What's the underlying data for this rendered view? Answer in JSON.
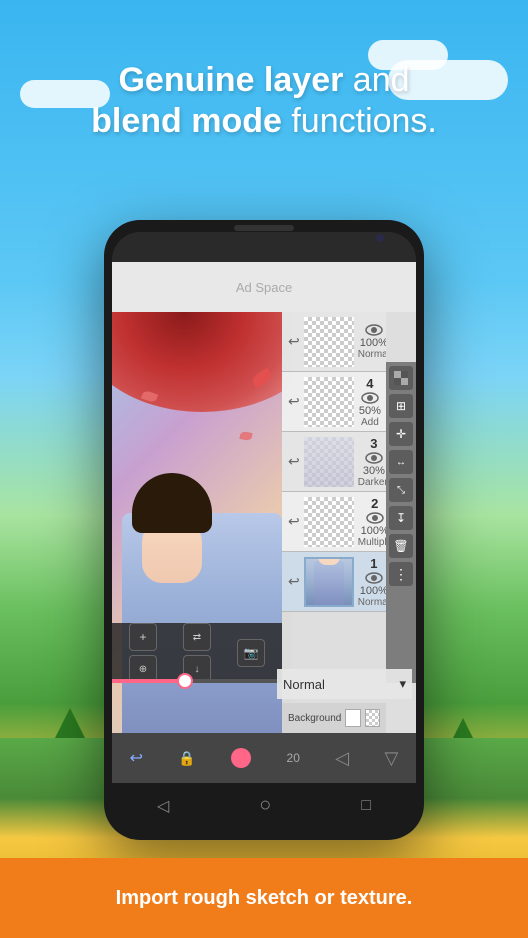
{
  "header": {
    "line1_bold": "Genuine layer",
    "line1_normal": " and",
    "line2_bold": "blend mode",
    "line2_normal": " functions."
  },
  "ad": {
    "text": "Ad Space"
  },
  "layers": [
    {
      "number": "",
      "opacity": "100%",
      "blend": "Normal",
      "thumbnail": "checkered-top"
    },
    {
      "number": "4",
      "opacity": "50%",
      "blend": "Add",
      "thumbnail": "checkered-4"
    },
    {
      "number": "3",
      "opacity": "30%",
      "blend": "Darken",
      "thumbnail": "checkered-3"
    },
    {
      "number": "2",
      "opacity": "100%",
      "blend": "Multiply",
      "thumbnail": "checkered-2"
    },
    {
      "number": "1",
      "opacity": "100%",
      "blend": "Normal",
      "thumbnail": "character-1"
    }
  ],
  "layer_bottom": {
    "background_label": "Background",
    "blend_mode": "Normal"
  },
  "toolbar_buttons": {
    "labels": [
      "⊞",
      "↯",
      "↔",
      "⊠",
      "↧",
      "🗑"
    ]
  },
  "canvas_bottom": {
    "add_icon": "+",
    "merge_icon": "⊞",
    "layer_icon": "⊟",
    "camera_icon": "📷"
  },
  "bottom_nav": {
    "back": "◁",
    "home": "○",
    "recent": "□"
  },
  "banner": {
    "text": "Import rough sketch or texture."
  },
  "colors": {
    "background_top": "#3ab5f0",
    "background_mid": "#5cc8f5",
    "trees": "#2a7a20",
    "flowers": "#f5c842",
    "banner": "#f07c1a",
    "phone_body": "#1a1a1a"
  }
}
